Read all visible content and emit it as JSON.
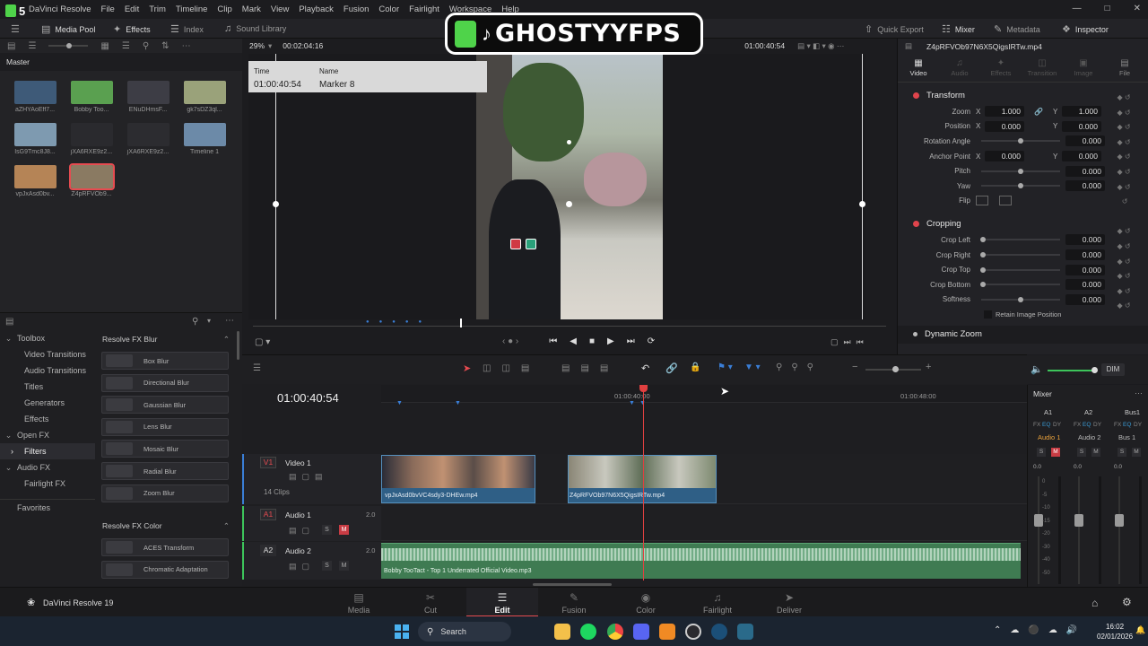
{
  "menubar": {
    "app_name": "DaVinci Resolve",
    "items": [
      "File",
      "Edit",
      "Trim",
      "Timeline",
      "Clip",
      "Mark",
      "View",
      "Playback",
      "Fusion",
      "Color",
      "Fairlight",
      "Workspace",
      "Help"
    ],
    "overlay_number": "5"
  },
  "watermark": {
    "text": "GHOSTYYFPS"
  },
  "toolbar": {
    "media_pool": "Media Pool",
    "effects": "Effects",
    "index": "Index",
    "sound_library": "Sound Library",
    "quick_export": "Quick Export",
    "mixer": "Mixer",
    "metadata": "Metadata",
    "inspector": "Inspector"
  },
  "mediapool": {
    "zoom": "29%",
    "duration": "00:02:04:16",
    "bin": "Master",
    "clips": [
      {
        "name": "aZHYAoEff7...",
        "color": "#3e5a78"
      },
      {
        "name": "Bobby Too...",
        "color": "#5aa050"
      },
      {
        "name": "ENuDHmsF...",
        "color": "#3d3d45"
      },
      {
        "name": "gk7sDZ3ql...",
        "color": "#9aa27a"
      },
      {
        "name": "IsG9Tmc8J8...",
        "color": "#7e9ab0"
      },
      {
        "name": "jXA6RXE9z2...",
        "color": "#2a2a2e"
      },
      {
        "name": "jXA6RXE9z2...",
        "color": "#2c2c30"
      },
      {
        "name": "Timeline 1",
        "color": "#6c8aa8"
      },
      {
        "name": "vpJxAsd0bv...",
        "color": "#b58456"
      },
      {
        "name": "Z4pRFVOb9...",
        "color": "#8a7a62"
      }
    ]
  },
  "viewer": {
    "timecode": "01:00:40:54",
    "marker": {
      "time_label": "Time",
      "time": "01:00:40:54",
      "name_label": "Name",
      "name": "Marker 8"
    }
  },
  "inspector": {
    "clip_title": "Z4pRFVOb97N6X5QigsIRTw.mp4",
    "tabs": [
      "Video",
      "Audio",
      "Effects",
      "Transition",
      "Image",
      "File"
    ],
    "transform": {
      "title": "Transform",
      "zoom": {
        "label": "Zoom",
        "x": "1.000",
        "y": "1.000"
      },
      "position": {
        "label": "Position",
        "x": "0.000",
        "y": "0.000"
      },
      "rotation": {
        "label": "Rotation Angle",
        "value": "0.000"
      },
      "anchor": {
        "label": "Anchor Point",
        "x": "0.000",
        "y": "0.000"
      },
      "pitch": {
        "label": "Pitch",
        "value": "0.000"
      },
      "yaw": {
        "label": "Yaw",
        "value": "0.000"
      },
      "flip": {
        "label": "Flip"
      }
    },
    "cropping": {
      "title": "Cropping",
      "crop_left": {
        "label": "Crop Left",
        "value": "0.000"
      },
      "crop_right": {
        "label": "Crop Right",
        "value": "0.000"
      },
      "crop_top": {
        "label": "Crop Top",
        "value": "0.000"
      },
      "crop_bottom": {
        "label": "Crop Bottom",
        "value": "0.000"
      },
      "softness": {
        "label": "Softness",
        "value": "0.000"
      },
      "retain": "Retain Image Position"
    },
    "dynamic_zoom": "Dynamic Zoom",
    "axis_x": "X",
    "axis_y": "Y"
  },
  "effects_panel": {
    "tree": [
      "Toolbox",
      "Video Transitions",
      "Audio Transitions",
      "Titles",
      "Generators",
      "Effects",
      "Open FX",
      "Filters",
      "Audio FX",
      "Fairlight FX",
      "Favorites"
    ],
    "blur_header": "Resolve FX Blur",
    "blur_items": [
      "Box Blur",
      "Directional Blur",
      "Gaussian Blur",
      "Lens Blur",
      "Mosaic Blur",
      "Radial Blur",
      "Zoom Blur"
    ],
    "color_header": "Resolve FX Color",
    "color_items": [
      "ACES Transform",
      "Chromatic Adaptation"
    ]
  },
  "timeline": {
    "timecode": "01:00:40:54",
    "ruler": [
      "01:00:40:00",
      "01:00:48:00"
    ],
    "tracks": {
      "v1": {
        "id": "V1",
        "name": "Video 1",
        "clips_count": "14 Clips"
      },
      "a1": {
        "id": "A1",
        "name": "Audio 1",
        "level": "2.0"
      },
      "a2": {
        "id": "A2",
        "name": "Audio 2",
        "level": "2.0"
      }
    },
    "clip1": "vpJxAsd0bvVC4sdy3-DHEw.mp4",
    "clip2": "Z4pRFVOb97N6X5QigsIRTw.mp4",
    "audio_clip": "Bobby TooTact - Top 1 Underrated Official Video.mp3",
    "dim": "DIM",
    "solo": "S",
    "mute": "M"
  },
  "mixer": {
    "title": "Mixer",
    "channels": [
      "A1",
      "A2",
      "Bus1"
    ],
    "fx": "FX",
    "eq": "EQ",
    "dy": "DY",
    "names": [
      "Audio 1",
      "Audio 2",
      "Bus 1"
    ],
    "level": "0.0",
    "solo": "S",
    "mute": "M",
    "scale": [
      "0",
      "-5",
      "-10",
      "-15",
      "-20",
      "-30",
      "-40",
      "-50"
    ]
  },
  "pages": {
    "app": "DaVinci Resolve 19",
    "items": [
      "Media",
      "Cut",
      "Edit",
      "Fusion",
      "Color",
      "Fairlight",
      "Deliver"
    ],
    "active": "Edit"
  },
  "taskbar": {
    "search": "Search",
    "time": "16:02",
    "date": "02/01/2026"
  },
  "colors": {
    "accent_red": "#e64b50",
    "playhead": "#e04040",
    "audio_green": "#3f7b52",
    "video_clip": "#2f5f86"
  }
}
